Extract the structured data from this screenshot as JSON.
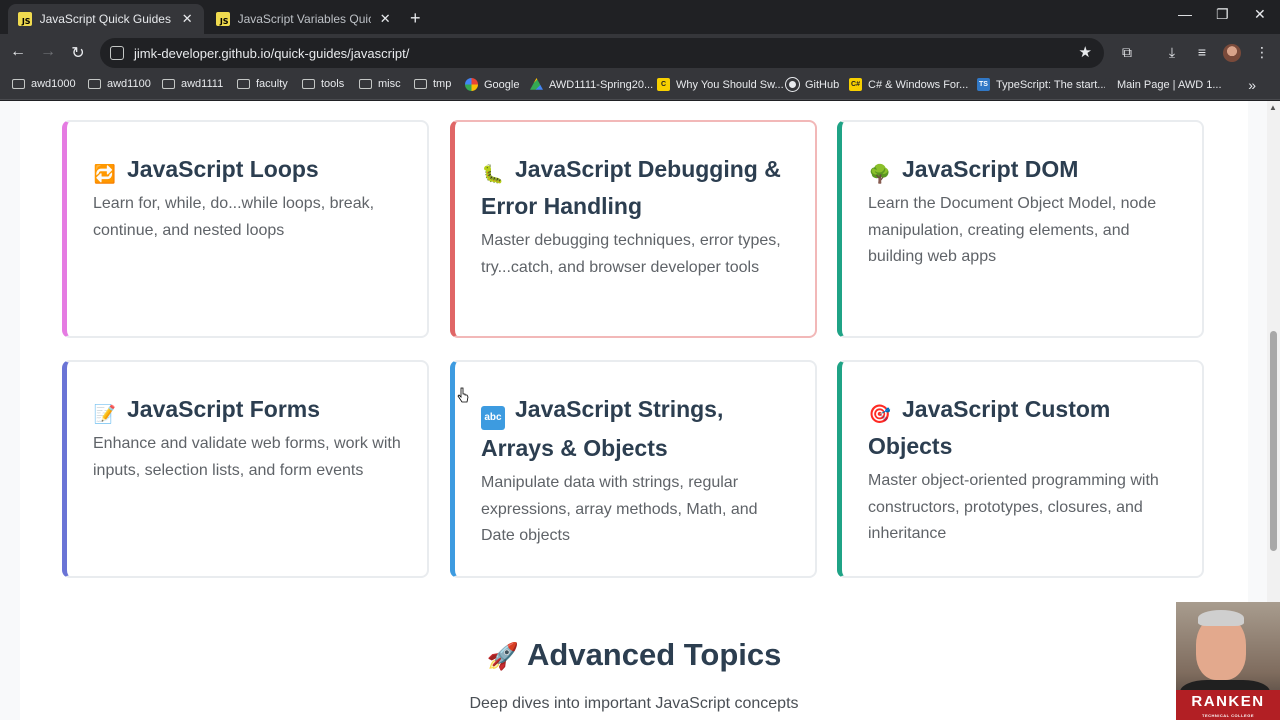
{
  "browser": {
    "tabs": [
      {
        "title": "JavaScript Quick Guides",
        "favicon": "JS",
        "active": true
      },
      {
        "title": "JavaScript Variables Quick Guide",
        "favicon": "JS",
        "active": false
      }
    ],
    "url": "jimk-developer.github.io/quick-guides/javascript/",
    "bookmarks": [
      {
        "label": "awd1000",
        "icon": "folder-icon"
      },
      {
        "label": "awd1100",
        "icon": "folder-icon"
      },
      {
        "label": "awd1111",
        "icon": "folder-icon"
      },
      {
        "label": "faculty",
        "icon": "folder-icon"
      },
      {
        "label": "tools",
        "icon": "folder-icon"
      },
      {
        "label": "misc",
        "icon": "folder-icon"
      },
      {
        "label": "tmp",
        "icon": "folder-icon"
      },
      {
        "label": "Google",
        "icon": "google-icon"
      },
      {
        "label": "AWD1111-Spring20...",
        "icon": "drive-icon"
      },
      {
        "label": "Why You Should Sw...",
        "icon": "site-icon"
      },
      {
        "label": "GitHub",
        "icon": "github-icon"
      },
      {
        "label": "C# & Windows For...",
        "icon": "csharp-icon"
      },
      {
        "label": "TypeScript: The start...",
        "icon": "typescript-icon"
      },
      {
        "label": "Main Page | AWD 1...",
        "icon": "site-icon"
      }
    ]
  },
  "cards": [
    {
      "title": "JavaScript Loops",
      "emoji": "🔁",
      "description": "Learn for, while, do...while loops, break, continue, and nested loops",
      "accent": "#e57be2"
    },
    {
      "title": "JavaScript Debugging & Error Handling",
      "emoji": "🐛",
      "description": "Master debugging techniques, error types, try...catch, and browser developer tools",
      "accent": "#e06666"
    },
    {
      "title": "JavaScript DOM",
      "emoji": "🌳",
      "description": "Learn the Document Object Model, node manipulation, creating elements, and building web apps",
      "accent": "#1fa386"
    },
    {
      "title": "JavaScript Forms",
      "emoji": "📝",
      "description": "Enhance and validate web forms, work with inputs, selection lists, and form events",
      "accent": "#6a74d6"
    },
    {
      "title": "JavaScript Strings, Arrays & Objects",
      "emoji": "🔤",
      "emoji_text": "abc",
      "description": "Manipulate data with strings, regular expressions, array methods, Math, and Date objects",
      "accent": "#3d9be0"
    },
    {
      "title": "JavaScript Custom Objects",
      "emoji": "🎯",
      "description": "Master object-oriented programming with constructors, prototypes, closures, and inheritance",
      "accent": "#1fa386"
    }
  ],
  "section": {
    "emoji": "🚀",
    "title": "Advanced Topics",
    "subtitle": "Deep dives into important JavaScript concepts"
  },
  "webcam": {
    "logo_text": "RANKEN",
    "logo_subtext": "TECHNICAL COLLEGE"
  }
}
